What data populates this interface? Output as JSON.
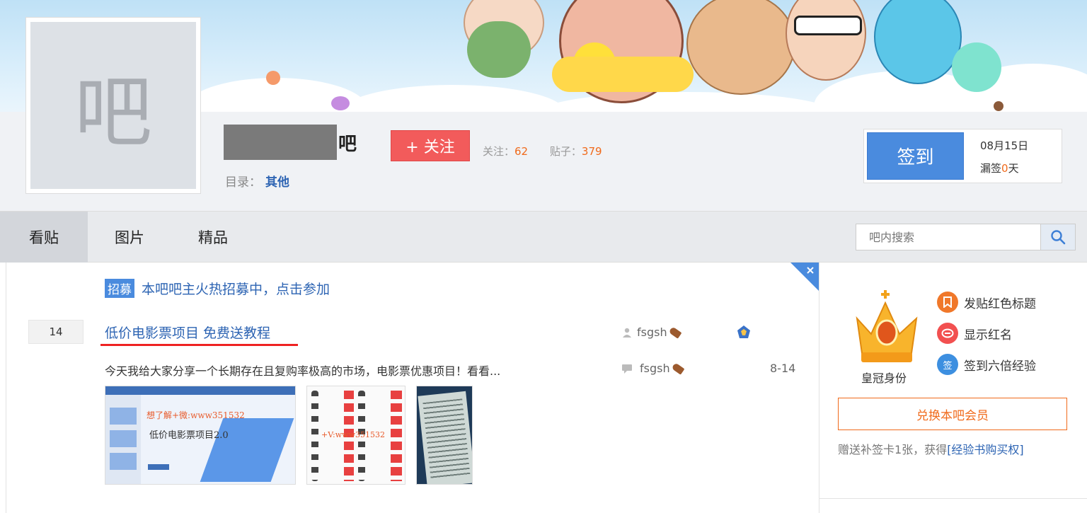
{
  "header": {
    "logo_glyph": "吧",
    "forum_suffix": "吧",
    "follow_label": "+ 关注",
    "follow_count_label": "关注：",
    "follow_count": "62",
    "post_count_label": "贴子：",
    "post_count": "379",
    "catalog_label": "目录：",
    "catalog_value": "其他"
  },
  "sign": {
    "button_label": "签到",
    "date": "08月15日",
    "missed_prefix": "漏签",
    "missed_count": "0",
    "missed_suffix": "天"
  },
  "nav": {
    "tabs": [
      {
        "label": "看贴",
        "active": true
      },
      {
        "label": "图片",
        "active": false
      },
      {
        "label": "精品",
        "active": false
      }
    ],
    "search_placeholder": "吧内搜索"
  },
  "recruit": {
    "tag": "招募",
    "text": "本吧吧主火热招募中，点击参加"
  },
  "thread": {
    "reply_count": "14",
    "title": "低价电影票项目 免费送教程",
    "author": "fsgsh",
    "last_replier": "fsgsh",
    "excerpt": "今天我给大家分享一个长期存在且复购率极高的市场，电影票优惠项目！看看...",
    "time": "8-14",
    "thumb1_watermark": "想了解+微:www351532",
    "thumb1_heading": "低价电影票项目2.0",
    "thumb2_watermark": "+V:www351532"
  },
  "sidebar": {
    "crown_label": "皇冠身份",
    "perks": [
      {
        "label": "发贴红色标题",
        "color": "#f0782a"
      },
      {
        "label": "显示红名",
        "color": "#f25050"
      },
      {
        "label": "签到六倍经验",
        "color": "#3d8fe0"
      }
    ],
    "perk3_icon_text": "签",
    "exchange_label": "兑换本吧会员",
    "gift_text": "赠送补签卡1张，获得",
    "gift_link": "[经验书购买权]"
  },
  "colors": {
    "accent_blue": "#2d64b3",
    "follow_red": "#f25b5b",
    "sign_blue": "#4a8bde",
    "highlight_orange": "#f06a1b"
  }
}
